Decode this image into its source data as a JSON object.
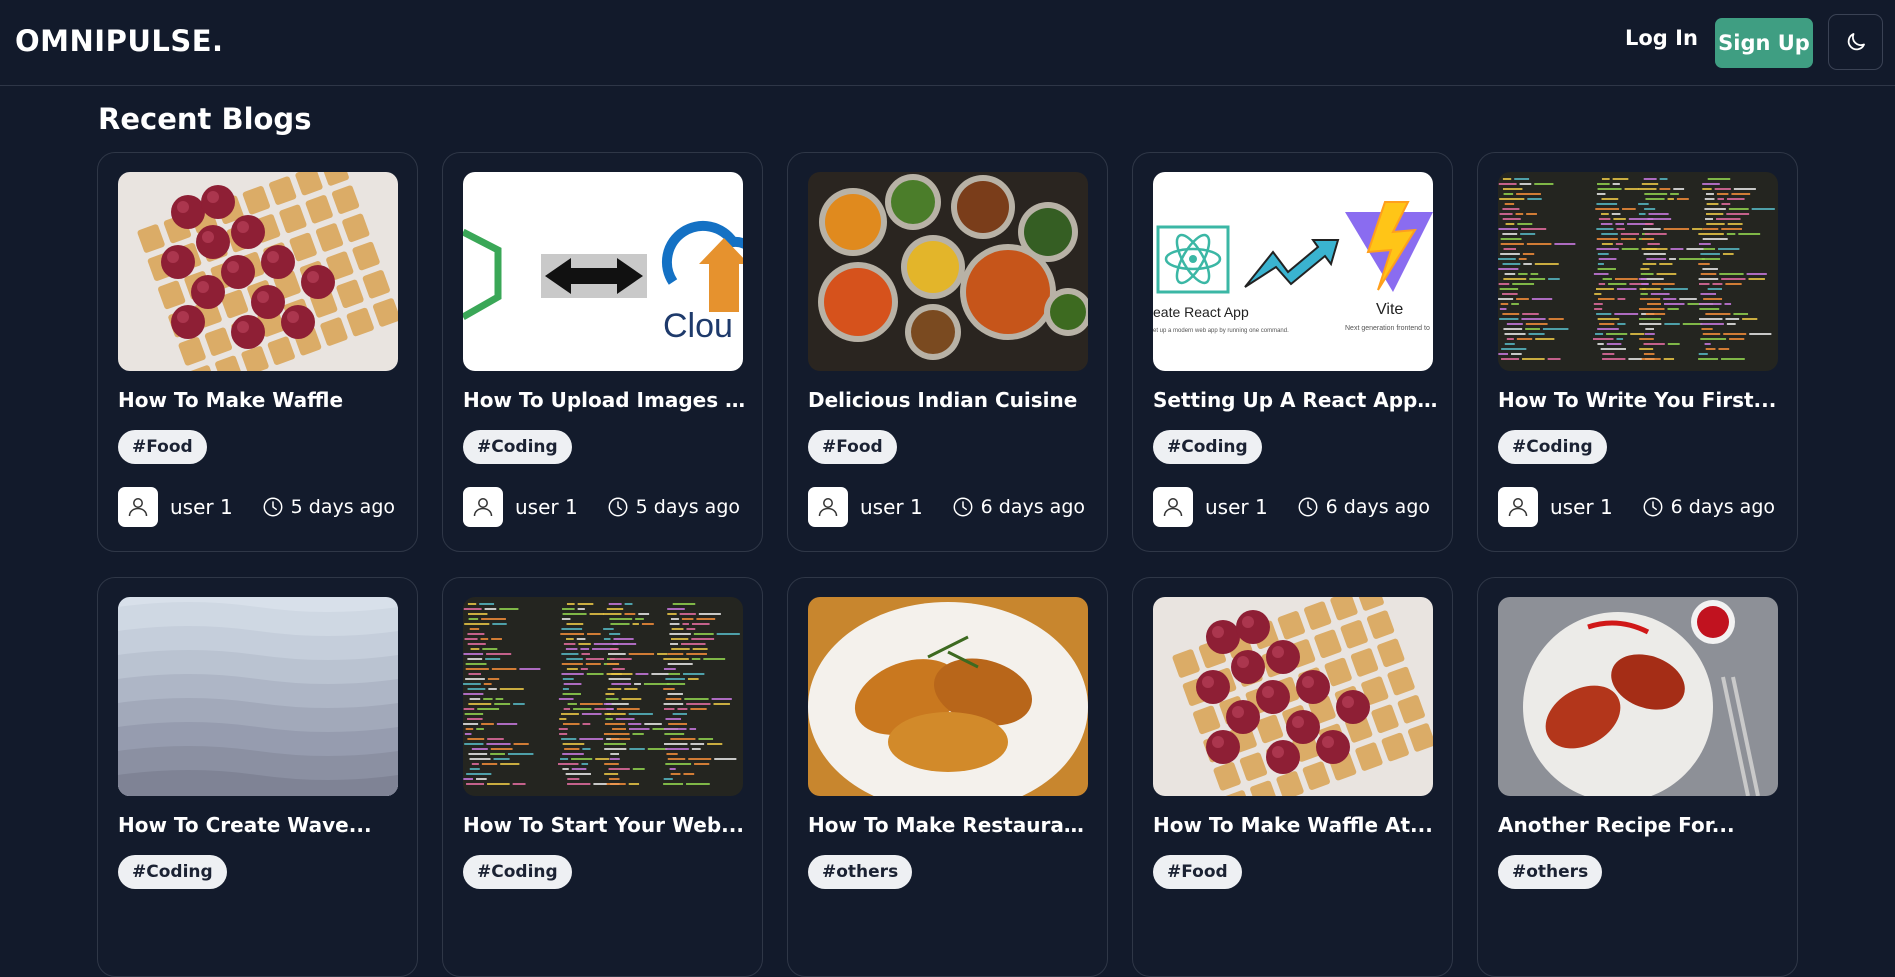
{
  "header": {
    "brand": "OMNIPULSE.",
    "login_label": "Log In",
    "signup_label": "Sign Up",
    "theme_icon": "moon-icon",
    "signup_color": "#3f9e82"
  },
  "main": {
    "section_title": "Recent Blogs",
    "cards": [
      {
        "title": "How To Make Waffle",
        "tag": "#Food",
        "author": "user 1",
        "time": "5 days ago",
        "image": "waffle"
      },
      {
        "title": "How To Upload Images T...",
        "tag": "#Coding",
        "author": "user 1",
        "time": "5 days ago",
        "image": "upload"
      },
      {
        "title": "Delicious Indian Cuisine",
        "tag": "#Food",
        "author": "user 1",
        "time": "6 days ago",
        "image": "indian"
      },
      {
        "title": "Setting Up A React App...",
        "tag": "#Coding",
        "author": "user 1",
        "time": "6 days ago",
        "image": "react"
      },
      {
        "title": "How To Write You First...",
        "tag": "#Coding",
        "author": "user 1",
        "time": "6 days ago",
        "image": "code"
      },
      {
        "title": "How To Create Wave...",
        "tag": "#Coding",
        "author": "",
        "time": "",
        "image": "wave"
      },
      {
        "title": "How To Start Your Web...",
        "tag": "#Coding",
        "author": "",
        "time": "",
        "image": "code"
      },
      {
        "title": "How To Make Restaurant...",
        "tag": "#others",
        "author": "",
        "time": "",
        "image": "chicken"
      },
      {
        "title": "How To Make Waffle At...",
        "tag": "#Food",
        "author": "",
        "time": "",
        "image": "waffle"
      },
      {
        "title": "Another Recipe For...",
        "tag": "#others",
        "author": "",
        "time": "",
        "image": "tandoori"
      }
    ],
    "image_text": {
      "react_label": "eate React App",
      "react_caption": "et up a modern web app by running one command.",
      "vite_label": "Vite",
      "vite_caption": "Next generation frontend to",
      "cloud_label": "Clou"
    }
  }
}
